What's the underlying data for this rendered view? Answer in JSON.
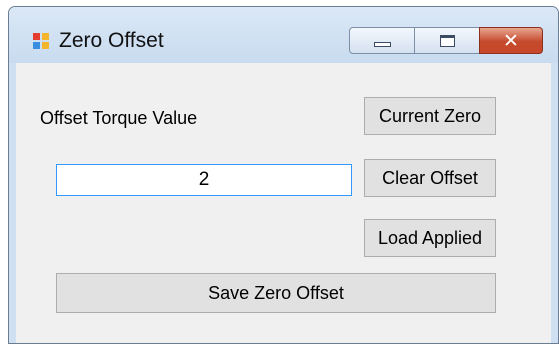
{
  "window": {
    "title": "Zero Offset",
    "buttons": {
      "minimize": "minimize-icon",
      "maximize": "maximize-icon",
      "close": "✕"
    }
  },
  "form": {
    "offset_label": "Offset Torque Value",
    "offset_value": "2",
    "current_zero_label": "Current Zero",
    "clear_offset_label": "Clear Offset",
    "load_applied_label": "Load Applied",
    "save_label": "Save Zero Offset"
  },
  "colors": {
    "input_focus_border": "#3399ff",
    "close_button": "#c7482a",
    "client_background": "#f0f0f0"
  }
}
